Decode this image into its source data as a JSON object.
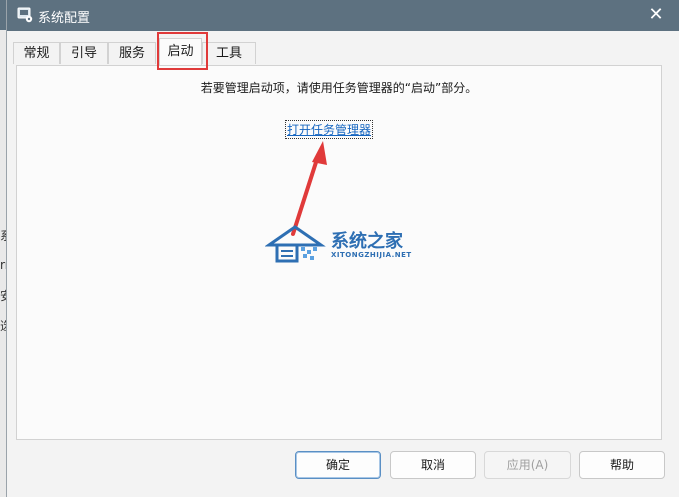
{
  "window": {
    "title": "系统配置",
    "close_icon": "close-icon"
  },
  "background_fragments": [
    "系",
    "rr",
    "安",
    "选"
  ],
  "tabs": [
    {
      "label": "常规"
    },
    {
      "label": "引导"
    },
    {
      "label": "服务"
    },
    {
      "label": "启动"
    },
    {
      "label": "工具"
    }
  ],
  "active_tab": "启动",
  "panel": {
    "info_text": "若要管理启动项，请使用任务管理器的“启动”部分。",
    "link_text": "打开任务管理器"
  },
  "watermark": {
    "cn": "系统之家",
    "en": "XITONGZHIJIA.NET"
  },
  "buttons": {
    "ok": "确定",
    "cancel": "取消",
    "apply": "应用(A)",
    "help": "帮助"
  },
  "colors": {
    "titlebar": "#5d7180",
    "highlight": "#e03a3a",
    "link": "#1565c0"
  }
}
